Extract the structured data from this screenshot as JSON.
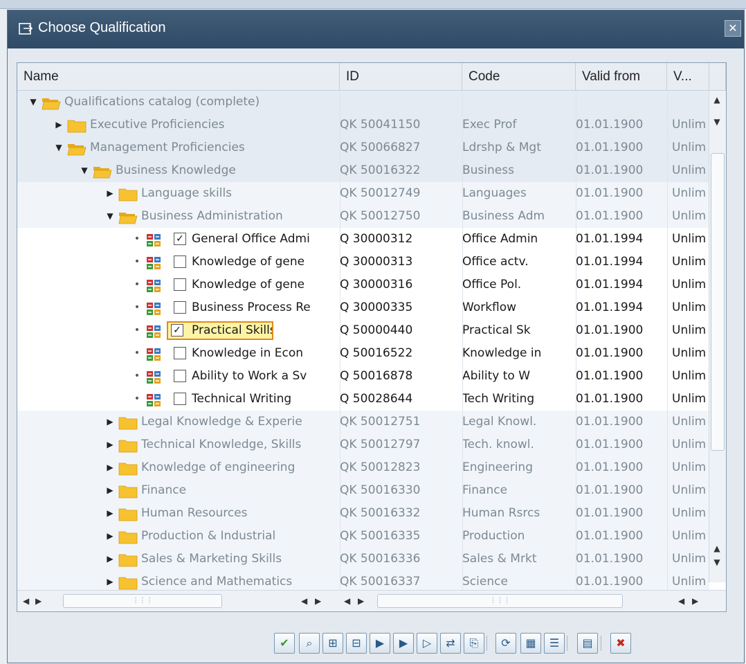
{
  "window": {
    "title": "Choose Qualification",
    "close_glyph": "✕"
  },
  "columns": [
    "Name",
    "ID",
    "Code",
    "Valid from",
    "V..."
  ],
  "rows": [
    {
      "kind": "grp",
      "level": 0,
      "state": "open",
      "name": "Qualifications catalog (complete)",
      "id": "",
      "code": "",
      "valid_from": "",
      "valid_to": ""
    },
    {
      "kind": "grp",
      "level": 1,
      "state": "closed",
      "name": "Executive Proficiencies",
      "id": "QK 50041150",
      "code": "Exec Prof",
      "valid_from": "01.01.1900",
      "valid_to": "Unlim"
    },
    {
      "kind": "grp",
      "level": 1,
      "state": "open",
      "name": "Management Proficiencies",
      "id": "QK 50066827",
      "code": "Ldrshp & Mgt",
      "valid_from": "01.01.1900",
      "valid_to": "Unlim"
    },
    {
      "kind": "grp",
      "level": 2,
      "state": "open",
      "name": "Business Knowledge",
      "id": "QK 50016322",
      "code": "Business",
      "valid_from": "01.01.1900",
      "valid_to": "Unlim"
    },
    {
      "kind": "grp2",
      "level": 3,
      "state": "closed",
      "name": "Language skills",
      "id": "QK 50012749",
      "code": "Languages",
      "valid_from": "01.01.1900",
      "valid_to": "Unlim"
    },
    {
      "kind": "grp2",
      "level": 3,
      "state": "open",
      "name": "Business Administration",
      "id": "QK 50012750",
      "code": "Business Adm",
      "valid_from": "01.01.1900",
      "valid_to": "Unlim"
    },
    {
      "kind": "item",
      "checked": true,
      "highlight": false,
      "name": "General Office Admi",
      "id": "Q  30000312",
      "code": "Office Admin",
      "valid_from": "01.01.1994",
      "valid_to": "Unlim"
    },
    {
      "kind": "item",
      "checked": false,
      "highlight": false,
      "name": "Knowledge of gene",
      "id": "Q  30000313",
      "code": "Office actv.",
      "valid_from": "01.01.1994",
      "valid_to": "Unlim"
    },
    {
      "kind": "item",
      "checked": false,
      "highlight": false,
      "name": "Knowledge of gene",
      "id": "Q  30000316",
      "code": "Office Pol.",
      "valid_from": "01.01.1994",
      "valid_to": "Unlim"
    },
    {
      "kind": "item",
      "checked": false,
      "highlight": false,
      "name": "Business Process Re",
      "id": "Q  30000335",
      "code": "Workflow",
      "valid_from": "01.01.1994",
      "valid_to": "Unlim"
    },
    {
      "kind": "item",
      "checked": true,
      "highlight": true,
      "name": "Practical Skills",
      "id": "Q  50000440",
      "code": "Practical Sk",
      "valid_from": "01.01.1900",
      "valid_to": "Unlim"
    },
    {
      "kind": "item",
      "checked": false,
      "highlight": false,
      "name": "Knowledge in Econ",
      "id": "Q  50016522",
      "code": "Knowledge in",
      "valid_from": "01.01.1900",
      "valid_to": "Unlim"
    },
    {
      "kind": "item",
      "checked": false,
      "highlight": false,
      "name": "Ability to Work a Sv",
      "id": "Q  50016878",
      "code": "Ability to W",
      "valid_from": "01.01.1900",
      "valid_to": "Unlim"
    },
    {
      "kind": "item",
      "checked": false,
      "highlight": false,
      "name": "Technical Writing",
      "id": "Q  50028644",
      "code": "Tech Writing",
      "valid_from": "01.01.1900",
      "valid_to": "Unlim"
    },
    {
      "kind": "grp2",
      "level": 3,
      "state": "closed",
      "name": "Legal Knowledge & Experie",
      "id": "QK 50012751",
      "code": "Legal Knowl.",
      "valid_from": "01.01.1900",
      "valid_to": "Unlim"
    },
    {
      "kind": "grp2",
      "level": 3,
      "state": "closed",
      "name": "Technical Knowledge, Skills",
      "id": "QK 50012797",
      "code": "Tech. knowl.",
      "valid_from": "01.01.1900",
      "valid_to": "Unlim"
    },
    {
      "kind": "grp2",
      "level": 3,
      "state": "closed",
      "name": "Knowledge of engineering",
      "id": "QK 50012823",
      "code": "Engineering",
      "valid_from": "01.01.1900",
      "valid_to": "Unlim"
    },
    {
      "kind": "grp2",
      "level": 3,
      "state": "closed",
      "name": "Finance",
      "id": "QK 50016330",
      "code": "Finance",
      "valid_from": "01.01.1900",
      "valid_to": "Unlim"
    },
    {
      "kind": "grp2",
      "level": 3,
      "state": "closed",
      "name": "Human Resources",
      "id": "QK 50016332",
      "code": "Human Rsrcs",
      "valid_from": "01.01.1900",
      "valid_to": "Unlim"
    },
    {
      "kind": "grp2",
      "level": 3,
      "state": "closed",
      "name": "Production & Industrial",
      "id": "QK 50016335",
      "code": "Production",
      "valid_from": "01.01.1900",
      "valid_to": "Unlim"
    },
    {
      "kind": "grp2",
      "level": 3,
      "state": "closed",
      "name": "Sales & Marketing Skills",
      "id": "QK 50016336",
      "code": "Sales & Mrkt",
      "valid_from": "01.01.1900",
      "valid_to": "Unlim"
    },
    {
      "kind": "grp2",
      "level": 3,
      "state": "closed",
      "name": "Science and Mathematics",
      "id": "QK 50016337",
      "code": "Science",
      "valid_from": "01.01.1900",
      "valid_to": "Unlim"
    }
  ],
  "toolbar": [
    {
      "name": "confirm-button",
      "glyph": "✔",
      "color": "#3c9a2a"
    },
    {
      "name": "find-button",
      "glyph": "⌕",
      "color": "#2a5a88"
    },
    {
      "name": "expand-all-button",
      "glyph": "⊞",
      "color": "#2a5a88"
    },
    {
      "name": "collapse-all-button",
      "glyph": "⊟",
      "color": "#2a5a88"
    },
    {
      "name": "select-block-button",
      "glyph": "▶",
      "color": "#2a5a88"
    },
    {
      "name": "select-all-button",
      "glyph": "▶",
      "color": "#2a5a88"
    },
    {
      "name": "deselect-all-button",
      "glyph": "▷",
      "color": "#2a5a88"
    },
    {
      "name": "swap-button",
      "glyph": "⇄",
      "color": "#2a5a88"
    },
    {
      "name": "copy-button",
      "glyph": "⎘",
      "color": "#2a5a88"
    },
    {
      "name": "refresh-button",
      "glyph": "⟳",
      "color": "#2a5a88"
    },
    {
      "name": "calendar-button",
      "glyph": "▦",
      "color": "#2a5a88"
    },
    {
      "name": "details-button",
      "glyph": "☰",
      "color": "#2a5a88"
    },
    {
      "name": "structure-button",
      "glyph": "▤",
      "color": "#2a5a88"
    },
    {
      "name": "cancel-button",
      "glyph": "✖",
      "color": "#c02a1a"
    }
  ],
  "colors": {
    "titlebar": "#2f4a66",
    "accent_yellow": "#f6c230",
    "highlight": "#fdf3a6"
  }
}
